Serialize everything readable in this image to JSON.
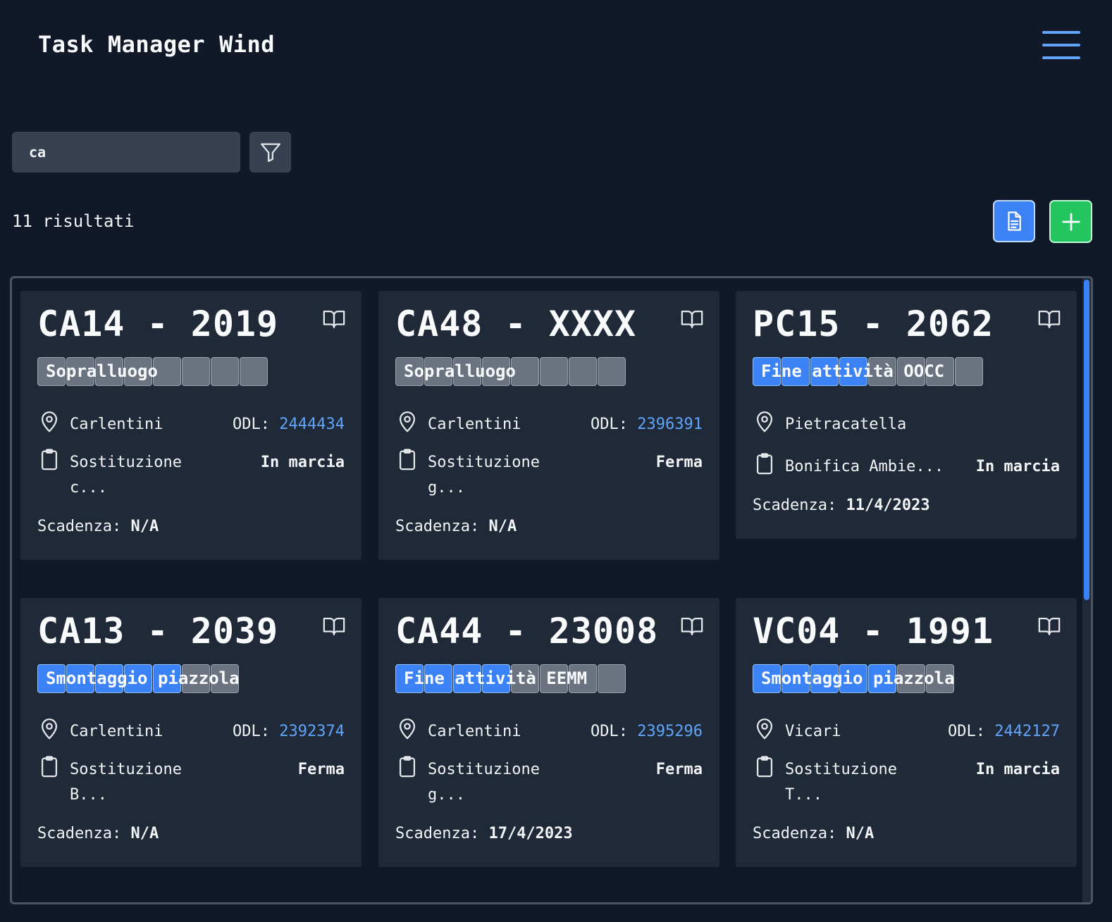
{
  "header": {
    "title": "Task Manager Wind",
    "menu_icon": "hamburger-menu-icon"
  },
  "search": {
    "value": "ca",
    "filter_icon": "filter-icon"
  },
  "results": {
    "count_label": "11 risultati",
    "export_icon": "document-icon",
    "add_icon": "plus-icon"
  },
  "colors": {
    "background": "#111827",
    "card": "#1f2937",
    "accent_blue": "#3b82f6",
    "accent_green": "#22c55e",
    "link": "#60a5fa",
    "tag_gray": "#6b7280"
  },
  "labels": {
    "odl_prefix": "ODL: ",
    "deadline_prefix": "Scadenza: "
  },
  "cards": [
    {
      "title": "CA14 - 2019",
      "tag": "Sopralluogo",
      "tag_color": "gray",
      "location": "Carlentini",
      "odl": "2444434",
      "description": "Sostituzione\nc...",
      "state": "In marcia",
      "deadline": "N/A"
    },
    {
      "title": "CA48 - XXXX",
      "tag": "Sopralluogo",
      "tag_color": "gray",
      "location": "Carlentini",
      "odl": "2396391",
      "description": "Sostituzione\ng...",
      "state": "Ferma",
      "deadline": "N/A"
    },
    {
      "title": "PC15 - 2062",
      "tag": "Fine attività OOCC",
      "tag_color": "blue",
      "location": "Pietracatella",
      "odl": "",
      "description": "Bonifica Ambie...",
      "state": "In marcia",
      "deadline": "11/4/2023"
    },
    {
      "title": "CA13 - 2039",
      "tag": "Smontaggio piazzola",
      "tag_color": "blue",
      "location": "Carlentini",
      "odl": "2392374",
      "description": "Sostituzione\nB...",
      "state": "Ferma",
      "deadline": "N/A"
    },
    {
      "title": "CA44 - 23008",
      "tag": "Fine attività EEMM",
      "tag_color": "blue",
      "location": "Carlentini",
      "odl": "2395296",
      "description": "Sostituzione\ng...",
      "state": "Ferma",
      "deadline": "17/4/2023"
    },
    {
      "title": "VC04 - 1991",
      "tag": "Smontaggio piazzola",
      "tag_color": "blue",
      "location": "Vicari",
      "odl": "2442127",
      "description": "Sostituzione\nT...",
      "state": "In marcia",
      "deadline": "N/A"
    }
  ]
}
